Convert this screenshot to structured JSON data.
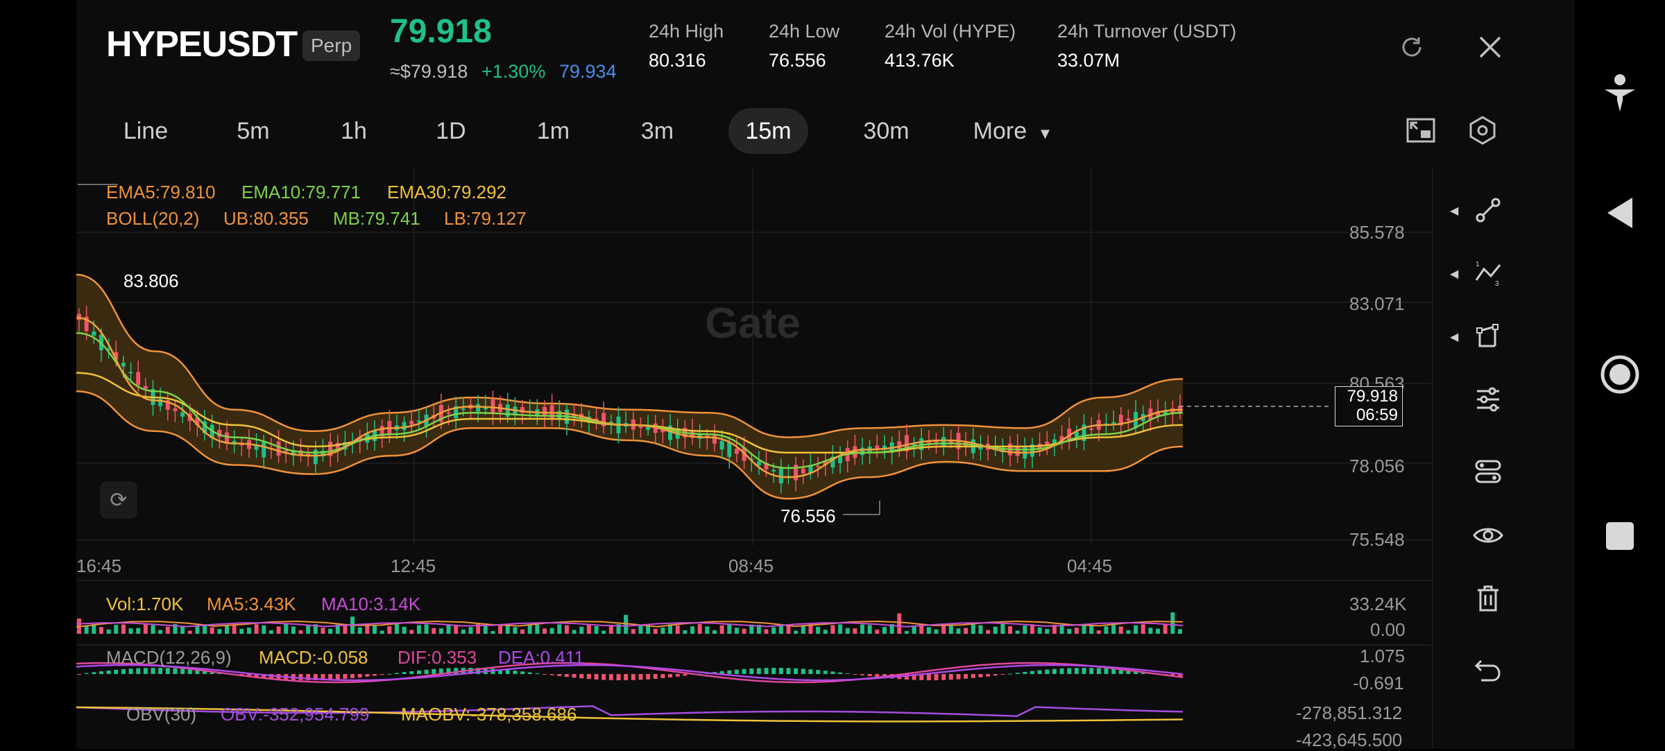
{
  "header": {
    "symbol": "HYPEUSDT",
    "badge": "Perp",
    "last_price": "79.918",
    "usd_price": "≈$79.918",
    "change_pct": "+1.30%",
    "mark_price": "79.934",
    "stats": [
      {
        "label": "24h   High",
        "value": "80.316"
      },
      {
        "label": "24h   Low",
        "value": "76.556"
      },
      {
        "label": "24h   Vol (HYPE)",
        "value": "413.76K"
      },
      {
        "label": "24h   Turnover (USDT)",
        "value": "33.07M"
      }
    ]
  },
  "tabs": [
    "Line",
    "5m",
    "1h",
    "1D",
    "1m",
    "3m",
    "15m",
    "30m",
    "More"
  ],
  "active_tab": "15m",
  "indicators": {
    "ema5": "EMA5:79.810",
    "ema10": "EMA10:79.771",
    "ema30": "EMA30:79.292",
    "boll": "BOLL(20,2)",
    "ub": "UB:80.355",
    "mb": "MB:79.741",
    "lb": "LB:79.127"
  },
  "price_axis": [
    "85.578",
    "83.071",
    "80.563",
    "78.056",
    "75.548"
  ],
  "time_axis": [
    "16:45",
    "12:45",
    "08:45",
    "04:45"
  ],
  "high_marker": "83.806",
  "low_marker": "76.556",
  "current_price_box": {
    "price": "79.918",
    "countdown": "06:59"
  },
  "watermark": "Gate",
  "volume": {
    "vol": "Vol:1.70K",
    "ma5": "MA5:3.43K",
    "ma10": "MA10:3.14K",
    "axis_top": "33.24K",
    "axis_bottom": "0.00"
  },
  "macd": {
    "label": "MACD(12,26,9)",
    "macd": "MACD:-0.058",
    "dif": "DIF:0.353",
    "dea": "DEA:0.411",
    "axis_top": "1.075",
    "axis_bottom": "-0.691"
  },
  "obv": {
    "label": "OBV(30)",
    "obv": "OBV:-352,954.799",
    "maobv": "MAOBV:-378,358.686",
    "axis_top": "-278,851.312",
    "axis_bottom": "-423,645.500"
  },
  "colors": {
    "green": "#1fc08a",
    "blue": "#3b82f6",
    "ema5": "#f0a23a",
    "ema10": "#7bd34a",
    "ema30": "#f0c23a",
    "boll_fill": "#3a2a10",
    "pink": "#e0479c",
    "purple": "#b048e8"
  },
  "chart_data": {
    "type": "line",
    "x": [
      "16:45",
      "12:45",
      "08:45",
      "04:45"
    ],
    "ylim": [
      75.548,
      85.578
    ],
    "series": [
      {
        "name": "EMA5",
        "values": [
          82.8,
          80.1,
          78.7,
          78.3,
          79.2,
          79.9,
          79.7,
          79.3,
          78.9,
          77.6,
          78.5,
          78.8,
          78.4,
          79.3,
          79.8
        ]
      },
      {
        "name": "EMA10",
        "values": [
          82.3,
          80.4,
          78.9,
          78.4,
          79.0,
          79.7,
          79.6,
          79.3,
          79.0,
          77.9,
          78.4,
          78.7,
          78.5,
          79.0,
          79.7
        ]
      },
      {
        "name": "EMA30",
        "values": [
          81.0,
          80.2,
          79.3,
          78.6,
          78.9,
          79.5,
          79.5,
          79.3,
          79.1,
          78.4,
          78.4,
          78.6,
          78.6,
          78.9,
          79.3
        ]
      }
    ]
  }
}
